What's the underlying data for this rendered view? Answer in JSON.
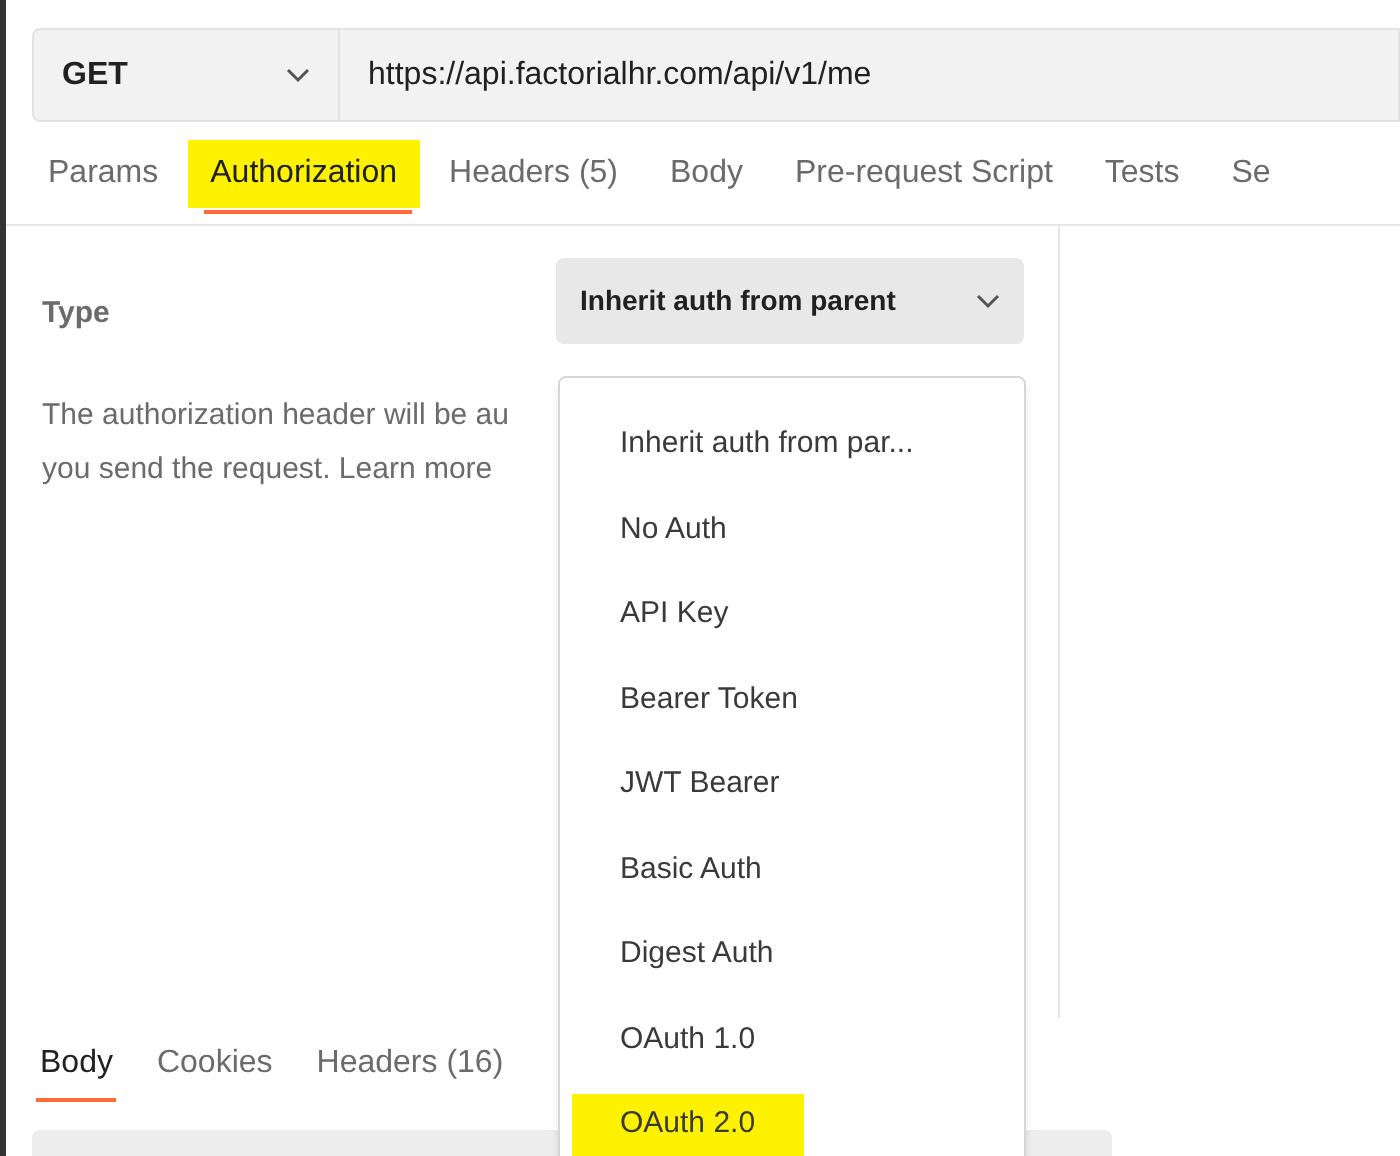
{
  "request": {
    "method": "GET",
    "url": "https://api.factorialhr.com/api/v1/me"
  },
  "request_tabs": [
    {
      "label": "Params",
      "selected": false,
      "highlighted": false
    },
    {
      "label": "Authorization",
      "selected": true,
      "highlighted": true
    },
    {
      "label": "Headers (5)",
      "selected": false,
      "highlighted": false
    },
    {
      "label": "Body",
      "selected": false,
      "highlighted": false
    },
    {
      "label": "Pre-request Script",
      "selected": false,
      "highlighted": false
    },
    {
      "label": "Tests",
      "selected": false,
      "highlighted": false
    },
    {
      "label": "Se",
      "selected": false,
      "highlighted": false
    }
  ],
  "auth": {
    "type_label": "Type",
    "type_value": "Inherit auth from parent",
    "description_lines": [
      "The authorization header will be au",
      "you send the request. Learn more"
    ]
  },
  "type_menu": [
    {
      "label": "Inherit auth from par...",
      "highlighted": false
    },
    {
      "label": "No Auth",
      "highlighted": false
    },
    {
      "label": "API Key",
      "highlighted": false
    },
    {
      "label": "Bearer Token",
      "highlighted": false
    },
    {
      "label": "JWT Bearer",
      "highlighted": false
    },
    {
      "label": "Basic Auth",
      "highlighted": false
    },
    {
      "label": "Digest Auth",
      "highlighted": false
    },
    {
      "label": "OAuth 1.0",
      "highlighted": false
    },
    {
      "label": "OAuth 2.0",
      "highlighted": true
    }
  ],
  "response_tabs": [
    {
      "label": "Body",
      "selected": true
    },
    {
      "label": "Cookies",
      "selected": false
    },
    {
      "label": "Headers (16)",
      "selected": false
    }
  ]
}
